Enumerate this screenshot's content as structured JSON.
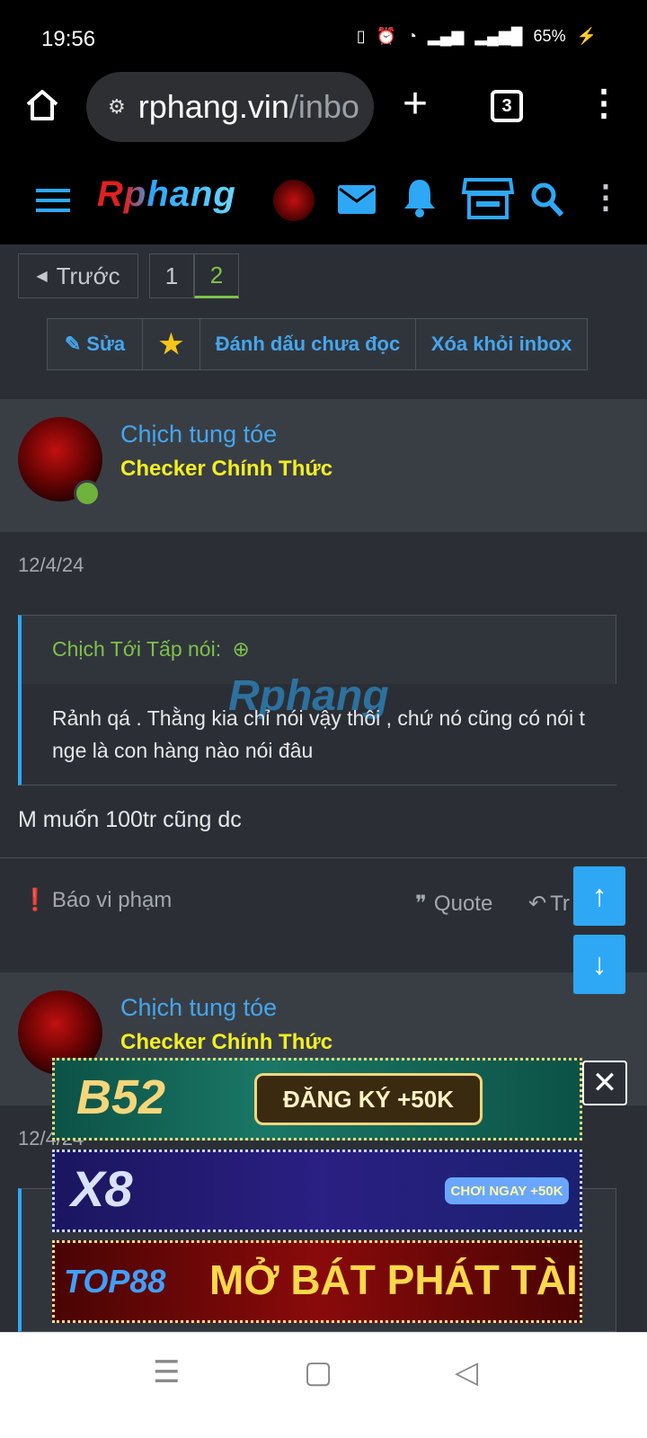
{
  "status_bar": {
    "time": "19:56",
    "battery": "65%"
  },
  "browser": {
    "url_domain": "rphang.vin",
    "url_path": "/inbo",
    "tab_count": "3"
  },
  "site": {
    "logo": "Rphang"
  },
  "pagination": {
    "prev_label": "Trước",
    "pages": [
      "1",
      "2"
    ],
    "current": "2"
  },
  "actions": {
    "edit": "Sửa",
    "star": "★",
    "mark_unread": "Đánh dấu chưa đọc",
    "remove": "Xóa khỏi inbox"
  },
  "posts": [
    {
      "username": "Chịch tung tóe",
      "role": "Checker Chính Thức",
      "date": "12/4/24",
      "quote_author": "Chịch Tới Tấp nói:",
      "quote_text": "Rảnh qá . Thằng kia chỉ nói vậy thôi , chứ nó cũng có nói t nge là con hàng nào nói đâu",
      "message": "M muốn 100tr cũng dc",
      "report": "Báo vi phạm",
      "quote_btn": "Quote",
      "reply_btn": "Tr"
    },
    {
      "username": "Chịch tung tóe",
      "role": "Checker Chính Thức",
      "date": "12/4/24"
    }
  ],
  "ads": {
    "ad1_brand": "B52",
    "ad1_cta": "ĐĂNG KÝ +50K",
    "ad2_brand": "X8",
    "ad2_cta": "CHƠI NGAY +50K",
    "ad3_brand": "TOP88",
    "ad3_cta": "MỞ BÁT PHÁT TÀI",
    "close": "✕"
  },
  "colors": {
    "accent": "#2ea8f5",
    "role": "#f2ef20",
    "quote_head": "#7ec24a",
    "bg": "#2b2f35"
  }
}
